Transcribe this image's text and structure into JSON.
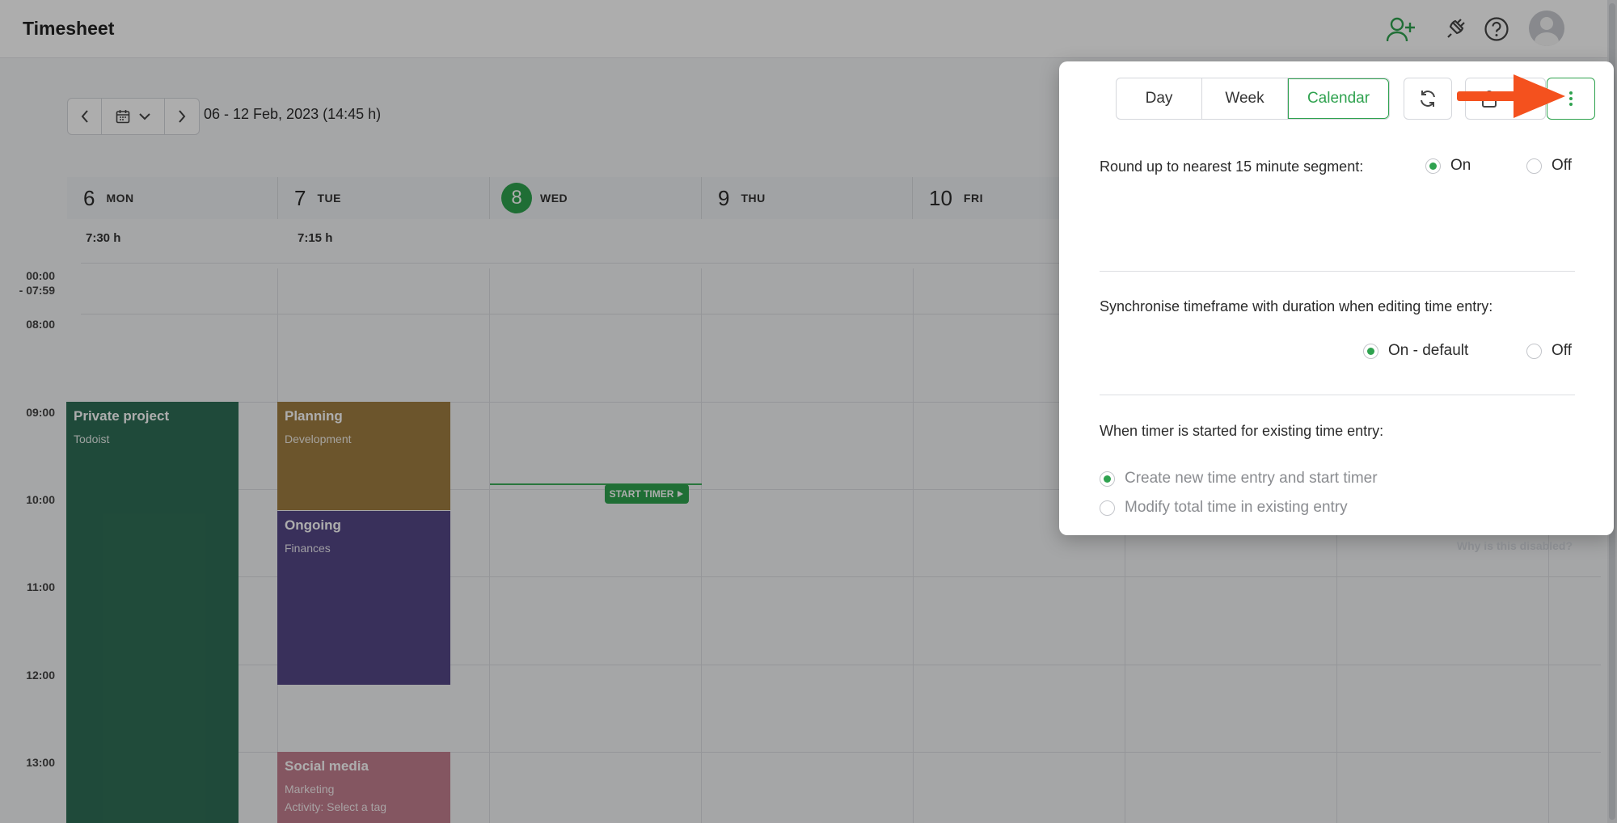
{
  "header": {
    "title": "Timesheet",
    "icons": [
      "add-user-icon",
      "plug-icon",
      "help-icon",
      "avatar"
    ]
  },
  "datenav": {
    "range": "06 - 12 Feb, 2023 (14:45 h)"
  },
  "days": [
    {
      "num": "6",
      "name": "MON",
      "total": "7:30 h",
      "today": false
    },
    {
      "num": "7",
      "name": "TUE",
      "total": "7:15 h",
      "today": false
    },
    {
      "num": "8",
      "name": "WED",
      "total": "",
      "today": true
    },
    {
      "num": "9",
      "name": "THU",
      "total": "",
      "today": false
    },
    {
      "num": "10",
      "name": "FRI",
      "total": "",
      "today": false
    }
  ],
  "timeline": {
    "first_label_line1": "00:00",
    "first_label_line2": "- 07:59",
    "hours": [
      "08:00",
      "09:00",
      "10:00",
      "11:00",
      "12:00",
      "13:00"
    ]
  },
  "events": [
    {
      "name": "Private project",
      "project": "Todoist",
      "extra": "",
      "color": "#2f6e56"
    },
    {
      "name": "Planning",
      "project": "Development",
      "extra": "",
      "color": "#a07e42"
    },
    {
      "name": "Ongoing",
      "project": "Finances",
      "extra": "",
      "color": "#554886"
    },
    {
      "name": "Social media",
      "project": "Marketing",
      "extra": "Activity: Select a tag",
      "color": "#c37f8f"
    }
  ],
  "start_timer_label": "START TIMER",
  "popup": {
    "tabs": [
      {
        "label": "Day",
        "active": false
      },
      {
        "label": "Week",
        "active": false
      },
      {
        "label": "Calendar",
        "active": true
      }
    ],
    "settings": [
      {
        "label": "Round up to nearest 15 minute segment:",
        "options": [
          {
            "label": "On",
            "selected": true
          },
          {
            "label": "Off",
            "selected": false
          }
        ]
      },
      {
        "label": "Synchronise timeframe with duration when editing time entry:",
        "options": [
          {
            "label": "On - default",
            "selected": true
          },
          {
            "label": "Off",
            "selected": false
          }
        ]
      },
      {
        "label": "When timer is started for existing time entry:",
        "options": [
          {
            "label": "Create new time entry and start timer",
            "selected": true
          },
          {
            "label": "Modify total time in existing entry",
            "selected": false
          }
        ]
      }
    ],
    "why_disabled": "Why is this disabled?"
  },
  "colors": {
    "accent": "#2fa24f",
    "annotation_arrow": "#f4511e"
  }
}
